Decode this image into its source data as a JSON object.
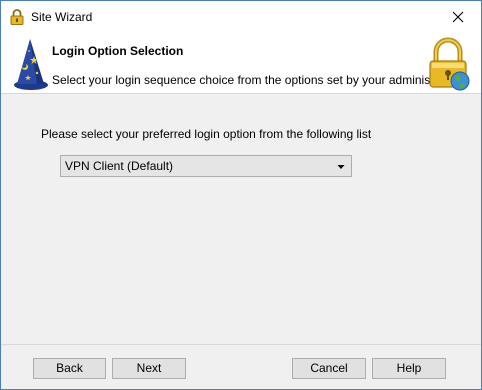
{
  "window": {
    "title": "Site Wizard",
    "close_icon": "close-icon"
  },
  "header": {
    "title": "Login Option Selection",
    "subtitle": "Select your login sequence choice from the options set by your administrator",
    "left_icon": "wizard-hat-icon",
    "right_icon": "padlock-globe-icon"
  },
  "body": {
    "prompt": "Please select your preferred  login option from the following list",
    "login_option": {
      "selected": "VPN Client  (Default)",
      "arrow_icon": "chevron-down-icon"
    }
  },
  "footer": {
    "back_label": "Back",
    "next_label": "Next",
    "cancel_label": "Cancel",
    "help_label": "Help"
  },
  "colors": {
    "window_border": "#4a7ec0",
    "dialog_background": "#f0f0f0",
    "header_background": "#ffffff",
    "button_face": "#e1e1e1",
    "lock_gold": "#e8b925",
    "hat_blue": "#2a4aa8"
  }
}
